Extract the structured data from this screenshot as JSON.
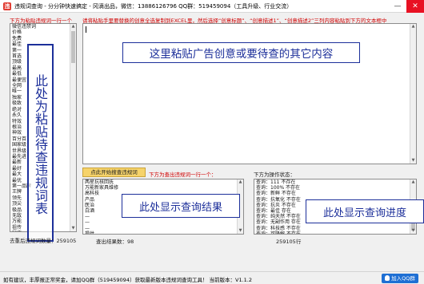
{
  "window": {
    "title": "违规词查询 - 分分钟快速搞定 - 冈滴出品，微信：13886126796 QQ群：519459094（工具升级、行业交流）",
    "app_icon": "违",
    "minimize": "—",
    "close": "✕"
  },
  "left_panel": {
    "caption": "下方为粘贴违规词一行一个",
    "items": [
      "微信违禁词",
      "价格",
      "免费",
      "最佳",
      "第一",
      "首选",
      "顶级",
      "最高",
      "最低",
      "最便宜",
      "全网",
      "唯一",
      "独家",
      "极致",
      "绝对",
      "永久",
      "特效",
      "根治",
      "神效",
      "百分百",
      "国家级",
      "世界级",
      "最先进",
      "最新",
      "最好",
      "最大",
      "最优",
      "第一品牌",
      "王牌",
      "领先",
      "顶尖",
      "极品",
      "无敌",
      "万能",
      "祖传",
      "秘方",
      "包治",
      "一次性",
      "绝无仅有",
      "史无前例",
      "前无古人",
      "独一无二"
    ],
    "note": "此处为粘贴待查违规词表",
    "count_label": "去重后违规词数量：259105"
  },
  "main_input": {
    "caption": "请将粘贴手里要替换的创意全选复制到EXCEL里，然后选择“创意标题”、“创意描述1”、“创意描述2”三列内容粘贴到下方的文本框中",
    "overlay": "这里粘贴广告创意或要待查的其它内容"
  },
  "query_button": {
    "label": "点此开始搜查违规词"
  },
  "results_panel": {
    "caption": "下方为查出违规词一行一个：",
    "items": [
      "两星抗核回抚",
      "万能新家具维修",
      "高科技",
      "产品",
      "医治",
      "白酒",
      "—",
      "—",
      "",
      "—",
      "提供"
    ],
    "overlay": "此处显示查询结果",
    "count_label": "查出结果数：98"
  },
  "status_panel": {
    "caption": "下方为操作状态：",
    "items": [
      "查询：111  不存在",
      "查询：100%  不存在",
      "查询：新鲜  不存在",
      "查询：抗氧化  不存在",
      "查询：抗炎  不存在",
      "查询：最佳  存在",
      "查询：纯天然  不存在",
      "查询：无副作用  存在",
      "查询：科技感  不存在",
      "查询：可降解  不存在",
      "查询：独家  存在",
      "查询：首选  不存在",
      "查询结束！"
    ],
    "overlay": "此处显示查询进度",
    "count_label": "259105行"
  },
  "statusbar": {
    "text": "如有建议，丰厚报正常奖金，请加QQ群（519459094）获取最新版本违规词查询工具！  当前版本：V1.1.2",
    "qq_button": "加入QQ群"
  }
}
